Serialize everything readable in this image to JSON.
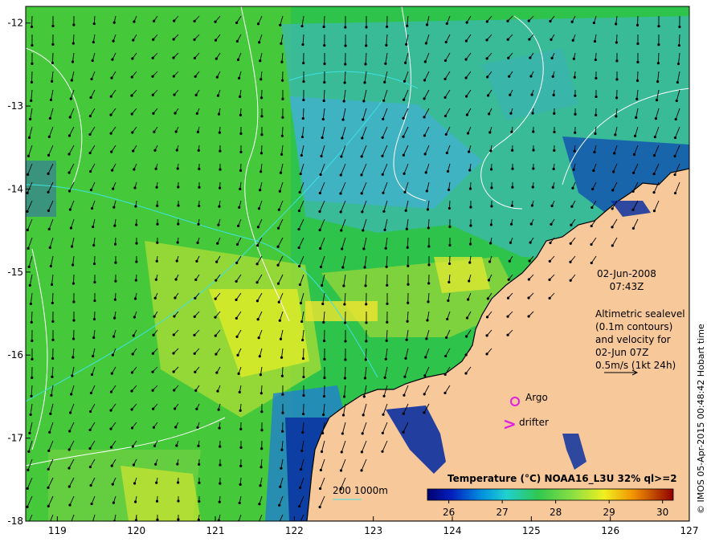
{
  "map": {
    "lon_range": [
      118.6,
      127
    ],
    "lat_range": [
      -18,
      -11.8
    ],
    "lon_ticks": [
      "119",
      "120",
      "121",
      "122",
      "123",
      "124",
      "125",
      "126",
      "127"
    ],
    "lat_ticks": [
      "-12",
      "-13",
      "-14",
      "-15",
      "-16",
      "-17",
      "-18"
    ]
  },
  "annotations": {
    "date": "02-Jun-2008",
    "time": "07:43Z",
    "altimetry_lines": [
      "Altimetric sealevel",
      "(0.1m contours)",
      "and velocity for",
      "02-Jun 07Z",
      "0.5m/s (1kt 24h)"
    ],
    "argo_label": "Argo",
    "drifter_label": "drifter",
    "drifter_glyph": ">",
    "depth_legend": "200  1000m"
  },
  "colorbar": {
    "title": "Temperature (°C) NOAA16_L3U 32% ql>=2",
    "range": [
      25.6,
      30.2
    ],
    "ticks": [
      "26",
      "27",
      "28",
      "29",
      "30"
    ]
  },
  "credit": "© IMOS 05-Apr-2015 00:48:42 Hobart time",
  "colors": {
    "land": "#f7c89a",
    "coast": "#000000",
    "marker": "#e020e0",
    "contour": "#ffffff",
    "bathy": "#40e0e0"
  }
}
